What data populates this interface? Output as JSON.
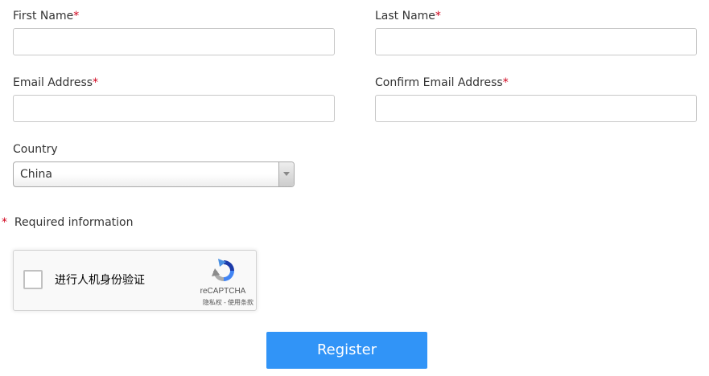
{
  "form": {
    "first_name": {
      "label": "First Name",
      "required_mark": "*",
      "value": ""
    },
    "last_name": {
      "label": "Last Name",
      "required_mark": "*",
      "value": ""
    },
    "email": {
      "label": "Email Address",
      "required_mark": "*",
      "value": ""
    },
    "confirm_email": {
      "label": "Confirm Email Address",
      "required_mark": "*",
      "value": ""
    },
    "country": {
      "label": "Country",
      "selected": "China"
    },
    "required_note": {
      "mark": "*",
      "text": "Required information"
    }
  },
  "captcha": {
    "label": "进行人机身份验证",
    "brand": "reCAPTCHA",
    "links": "隐私权 - 使用条款",
    "icon": "recaptcha-logo-icon"
  },
  "register": {
    "label": "Register"
  },
  "colors": {
    "required": "#d0021b",
    "button": "#3194f7",
    "button_text": "#ffffff",
    "input_border": "#c8c8c8"
  }
}
